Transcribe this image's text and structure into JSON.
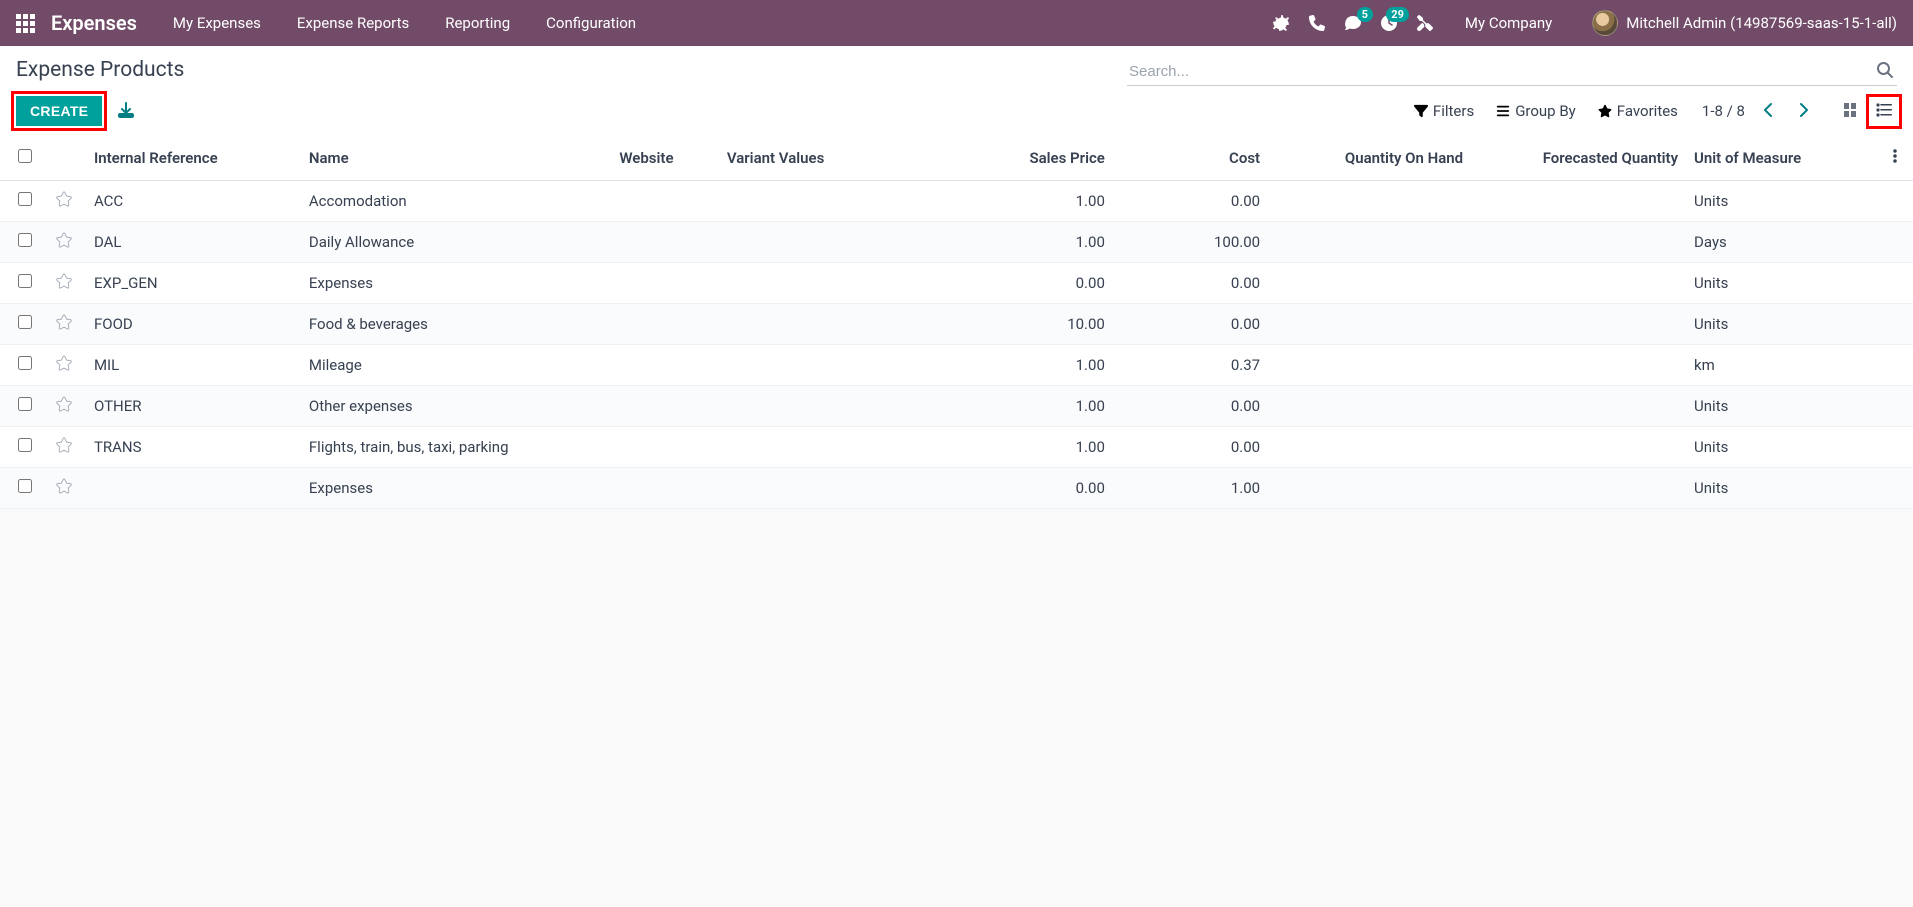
{
  "navbar": {
    "brand": "Expenses",
    "links": [
      "My Expenses",
      "Expense Reports",
      "Reporting",
      "Configuration"
    ],
    "chat_badge": "5",
    "activity_badge": "29",
    "company": "My Company",
    "user": "Mitchell Admin (14987569-saas-15-1-all)"
  },
  "controlPanel": {
    "title": "Expense Products",
    "createLabel": "CREATE",
    "searchPlaceholder": "Search...",
    "filtersLabel": "Filters",
    "groupByLabel": "Group By",
    "favoritesLabel": "Favorites",
    "pager": "1-8 / 8"
  },
  "table": {
    "headers": {
      "ref": "Internal Reference",
      "name": "Name",
      "website": "Website",
      "variant": "Variant Values",
      "price": "Sales Price",
      "cost": "Cost",
      "qty": "Quantity On Hand",
      "forecast": "Forecasted Quantity",
      "uom": "Unit of Measure"
    },
    "rows": [
      {
        "ref": "ACC",
        "name": "Accomodation",
        "price": "1.00",
        "cost": "0.00",
        "uom": "Units"
      },
      {
        "ref": "DAL",
        "name": "Daily Allowance",
        "price": "1.00",
        "cost": "100.00",
        "uom": "Days"
      },
      {
        "ref": "EXP_GEN",
        "name": "Expenses",
        "price": "0.00",
        "cost": "0.00",
        "uom": "Units"
      },
      {
        "ref": "FOOD",
        "name": "Food & beverages",
        "price": "10.00",
        "cost": "0.00",
        "uom": "Units"
      },
      {
        "ref": "MIL",
        "name": "Mileage",
        "price": "1.00",
        "cost": "0.37",
        "uom": "km"
      },
      {
        "ref": "OTHER",
        "name": "Other expenses",
        "price": "1.00",
        "cost": "0.00",
        "uom": "Units"
      },
      {
        "ref": "TRANS",
        "name": "Flights, train, bus, taxi, parking",
        "price": "1.00",
        "cost": "0.00",
        "uom": "Units"
      },
      {
        "ref": "",
        "name": "Expenses",
        "price": "0.00",
        "cost": "1.00",
        "uom": "Units"
      }
    ]
  }
}
